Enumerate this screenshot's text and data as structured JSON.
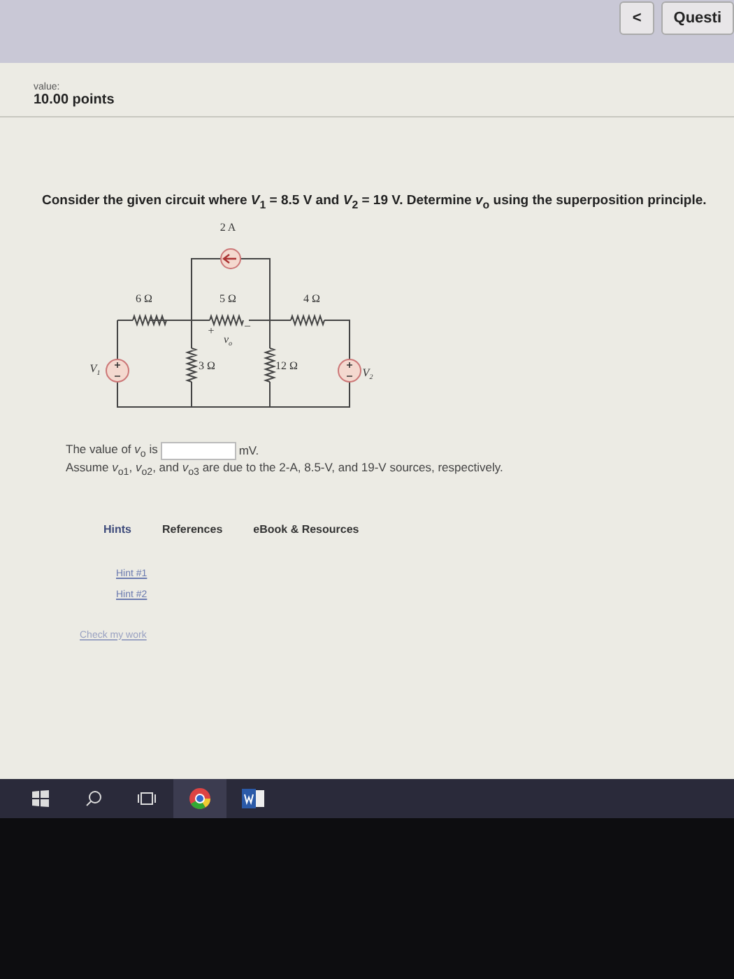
{
  "header": {
    "back_button": "<",
    "question_button": "Questi"
  },
  "value": {
    "label": "value:",
    "points": "10.00 points"
  },
  "question": "Consider the given circuit where *V*$_{1}$ = 8.5 V and *V*$_{2}$ = 19 V. Determine *v*$_{o}$ using the superposition principle.",
  "circuit": {
    "labels": [
      {
        "kind": "source",
        "text": "2 A"
      },
      {
        "kind": "r6",
        "text": "6 Ω"
      },
      {
        "kind": "r5",
        "text": "5 Ω"
      },
      {
        "kind": "r4",
        "text": "4 Ω"
      },
      {
        "kind": "plus",
        "text": "+"
      },
      {
        "kind": "minus",
        "text": "–"
      },
      {
        "kind": "vo",
        "text": "v$_{o}$"
      },
      {
        "kind": "v1",
        "text": "V$_{1}$"
      },
      {
        "kind": "r3",
        "text": "3 Ω"
      },
      {
        "kind": "r12",
        "text": "12 Ω"
      },
      {
        "kind": "v2",
        "text": "V$_{2}$"
      }
    ]
  },
  "answer": {
    "prefix": "The value of *v*$_{o}$ is",
    "unit": "mV."
  },
  "assume": "Assume *v*$_{o1}$, *v*$_{o2}$, and *v*$_{o3}$ are due to the 2-A, 8.5-V, and 19-V sources, respectively.",
  "tabs": [
    {
      "label": "Hints",
      "selected": true
    },
    {
      "label": "References",
      "selected": false
    },
    {
      "label": "eBook & Resources",
      "selected": false
    }
  ],
  "hints": [
    "Hint #1",
    "Hint #2"
  ],
  "check_link": "Check my work"
}
